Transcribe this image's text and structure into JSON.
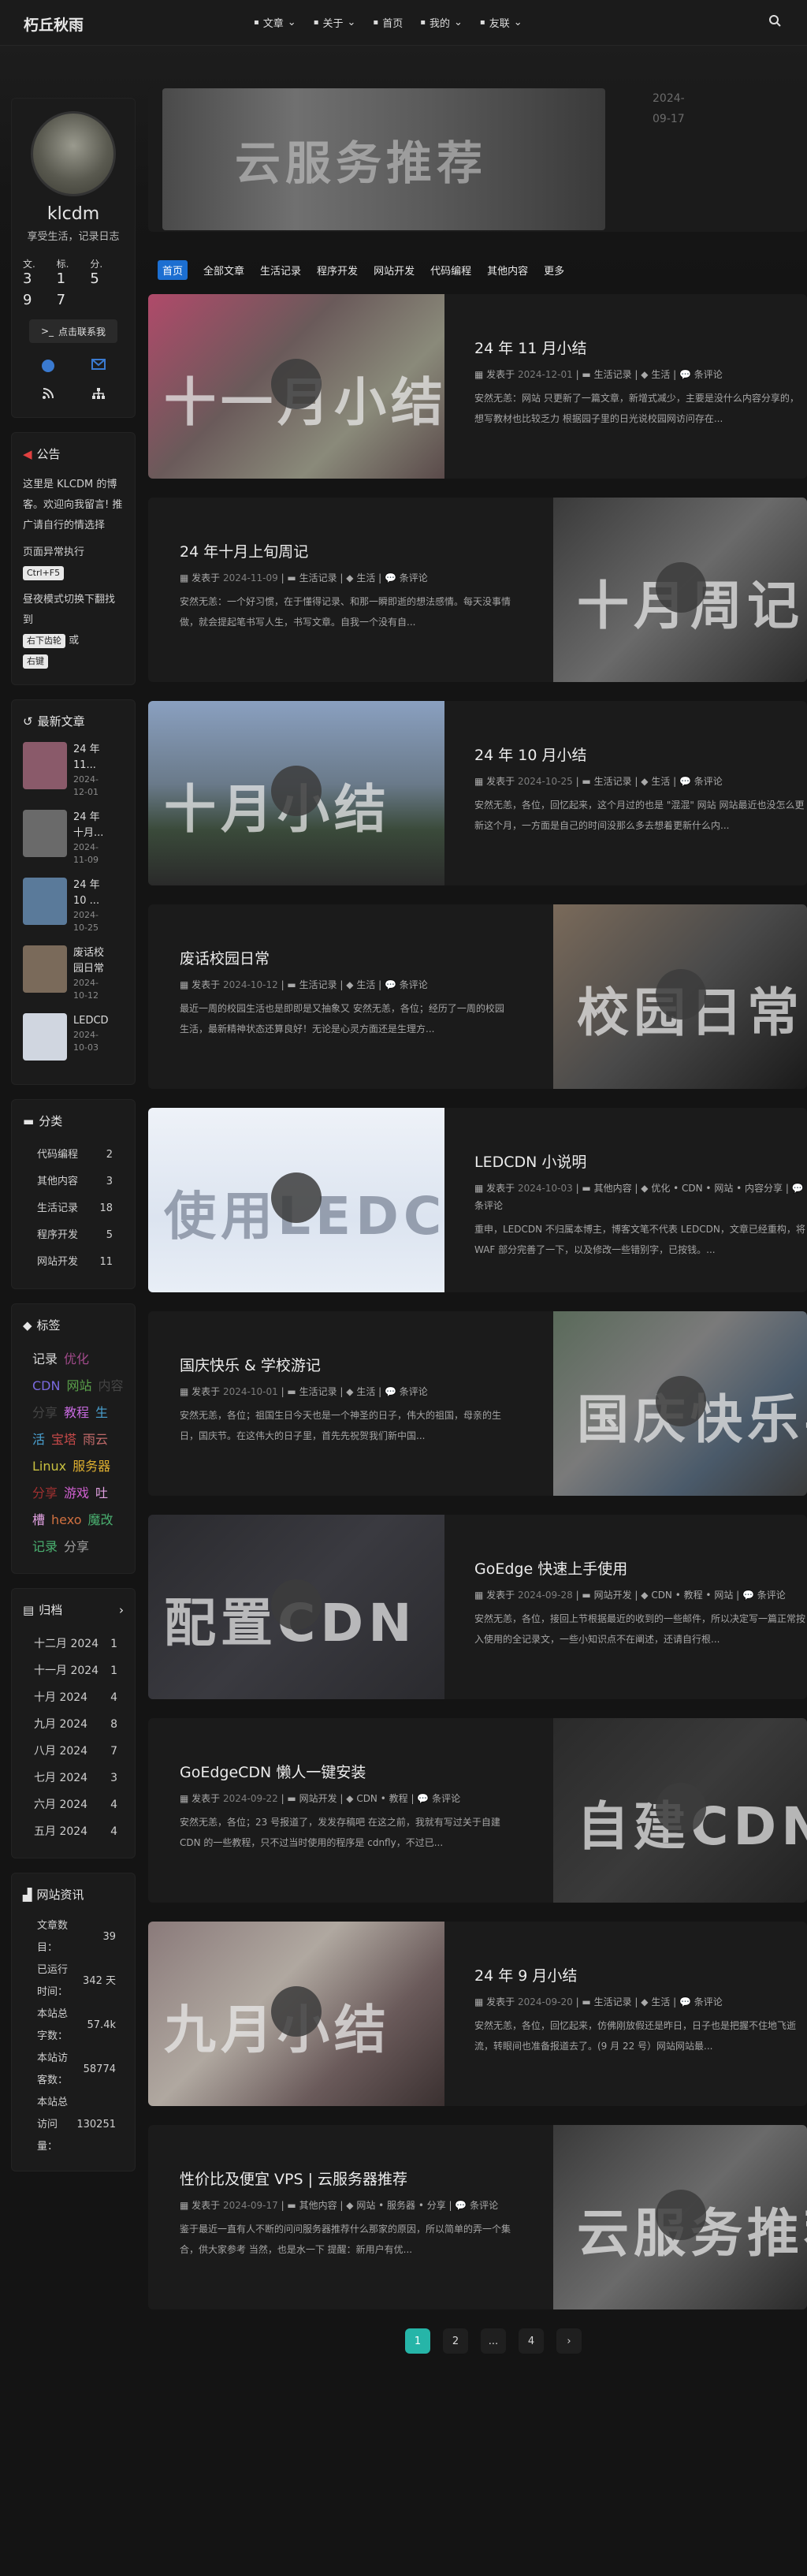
{
  "nav": {
    "brand": "朽丘秋雨",
    "menu": [
      {
        "label": "文章",
        "icon": "book-icon",
        "caret": true
      },
      {
        "label": "关于",
        "icon": "list-icon",
        "caret": true
      },
      {
        "label": "首页",
        "icon": "home-icon",
        "caret": false
      },
      {
        "label": "我的",
        "icon": "file-icon",
        "caret": true
      },
      {
        "label": "友联",
        "icon": "link-icon",
        "caret": true
      }
    ]
  },
  "profile": {
    "name": "klcdm",
    "desc": "享受生活，记录日志",
    "stats": [
      {
        "label": "文.",
        "value": "3"
      },
      {
        "label": "标.",
        "value": "1"
      },
      {
        "label": "分.",
        "value": "5"
      },
      {
        "label": "",
        "value": "9"
      },
      {
        "label": "",
        "value": "7"
      }
    ],
    "contact_button": "点击联系我",
    "socials": [
      "github-icon",
      "mail-icon",
      "rss-icon",
      "sitemap-icon"
    ]
  },
  "notice": {
    "title": "公告",
    "text1": "这里是 KLCDM 的博客。欢迎向我留言! 推广请自行的情选择",
    "text2": "页面异常执行",
    "key1": "Ctrl+F5",
    "text3": "昼夜模式切换下翻找到",
    "key2": "右下齿轮",
    "text4": "或",
    "key3": "右键"
  },
  "recent": {
    "title": "最新文章",
    "items": [
      {
        "title": "24 年 11...",
        "date": "2024-12-01",
        "color": "#8a5a6a"
      },
      {
        "title": "24 年十月...",
        "date": "2024-11-09",
        "color": "#6a6a6a"
      },
      {
        "title": "24 年 10 ...",
        "date": "2024-10-25",
        "color": "#5a7a9a"
      },
      {
        "title": "废话校园日常",
        "date": "2024-10-12",
        "color": "#7a6a5a"
      },
      {
        "title": "LEDCDN...",
        "date": "2024-10-03",
        "color": "#d0d6e0"
      }
    ]
  },
  "categories": {
    "title": "分类",
    "items": [
      {
        "name": "代码编程",
        "count": "2"
      },
      {
        "name": "其他内容",
        "count": "3"
      },
      {
        "name": "生活记录",
        "count": "18"
      },
      {
        "name": "程序开发",
        "count": "5"
      },
      {
        "name": "网站开发",
        "count": "11"
      }
    ]
  },
  "tags": {
    "title": "标签",
    "items": [
      {
        "t": "记录",
        "c": "#d8d8d8"
      },
      {
        "t": "优化",
        "c": "#a04a8a"
      },
      {
        "t": "CDN",
        "c": "#7a6adf"
      },
      {
        "t": "网站",
        "c": "#5aa04a"
      },
      {
        "t": "内容分享",
        "c": "#444"
      },
      {
        "t": "教程",
        "c": "#c86ae0"
      },
      {
        "t": "生活",
        "c": "#4aa0d0"
      },
      {
        "t": "宝塔",
        "c": "#c84a4a"
      },
      {
        "t": "雨云",
        "c": "#c06a6a"
      },
      {
        "t": "Linux",
        "c": "#c8c040"
      },
      {
        "t": "服务器",
        "c": "#e0b030"
      },
      {
        "t": "分享",
        "c": "#a03030"
      },
      {
        "t": "游戏",
        "c": "#d060d0"
      },
      {
        "t": "吐槽",
        "c": "#e0a0e0"
      },
      {
        "t": "hexo",
        "c": "#d07040"
      },
      {
        "t": "魔改记录",
        "c": "#4ab070"
      },
      {
        "t": "分享",
        "c": "#a0a0a0"
      }
    ]
  },
  "archive": {
    "title": "归档",
    "items": [
      {
        "m": "十二月 2024",
        "n": "1"
      },
      {
        "m": "十一月 2024",
        "n": "1"
      },
      {
        "m": "十月 2024",
        "n": "4"
      },
      {
        "m": "九月 2024",
        "n": "8"
      },
      {
        "m": "八月 2024",
        "n": "7"
      },
      {
        "m": "七月 2024",
        "n": "3"
      },
      {
        "m": "六月 2024",
        "n": "4"
      },
      {
        "m": "五月 2024",
        "n": "4"
      }
    ]
  },
  "siteinfo": {
    "title": "网站资讯",
    "items": [
      {
        "k": "文章数目：",
        "v": "39"
      },
      {
        "k": "已运行时间：",
        "v": "342 天"
      },
      {
        "k": "本站总字数：",
        "v": "57.4k"
      },
      {
        "k": "本站访客数：",
        "v": "58774"
      },
      {
        "k": "本站总访问量：",
        "v": "130251"
      }
    ]
  },
  "hero": {
    "word": "云服务推荐",
    "date": "2024-09-17"
  },
  "tabs": [
    "首页",
    "全部文章",
    "生活记录",
    "程序开发",
    "网站开发",
    "代码编程",
    "其他内容",
    "更多"
  ],
  "posts": [
    {
      "title": "24 年 11 月小结",
      "word": "十一月小结",
      "date": "2024-12-01",
      "cats": "生活记录",
      "tags": "生活",
      "comment": "条评论",
      "excerpt": "安然无恙：网站 只更新了一篇文章，新增式减少，主要是没什么内容分享的，想写教材也比较乏力 根据园子里的日光说校园网访问存在...",
      "side": "l",
      "bg": "linear-gradient(135deg,#b04a6a,#6a5a5a 40%,#8a8a7a 70%,#5a4a4a)"
    },
    {
      "title": "24 年十月上旬周记",
      "word": "十月周记",
      "date": "2024-11-09",
      "cats": "生活记录",
      "tags": "生活",
      "comment": "条评论",
      "excerpt": "安然无恙：一个好习惯，在于懂得记录、和那一瞬即逝的想法感情。每天没事情做，就会提起笔书写人生，书写文章。自我一个没有自...",
      "side": "r",
      "bg": "linear-gradient(135deg,#3a3a3a,#6a6a6a 50%,#2a2a2a)"
    },
    {
      "title": "24 年 10 月小结",
      "word": "十月小结",
      "date": "2024-10-25",
      "cats": "生活记录",
      "tags": "生活",
      "comment": "条评论",
      "excerpt": "安然无恙，各位，回忆起来，这个月过的也是 \"混混\" 网站 网站最近也没怎么更新这个月，一方面是自己的时间没那么多去想着更新什么内...",
      "side": "l",
      "bg": "linear-gradient(180deg,#8aa0c0,#6a7a8a 45%,#3a4a3a 70%,#2a2a2a)"
    },
    {
      "title": "废话校园日常",
      "word": "校园日常",
      "date": "2024-10-12",
      "cats": "生活记录",
      "tags": "生活",
      "comment": "条评论",
      "excerpt": "最近一周的校园生活也是即即是又抽象又 安然无恙，各位；经历了一周的校园生活，最新精神状态还算良好！无论是心灵方面还是生理方...",
      "side": "r",
      "bg": "linear-gradient(135deg,#7a6a5a,#4a4a4a 50%,#1a1a1a)"
    },
    {
      "title": "LEDCDN 小说明",
      "word": "使用LEDCDN",
      "date": "2024-10-03",
      "cats": "其他内容",
      "tags": "优化 • CDN • 网站 • 内容分享",
      "comment": "条评论",
      "excerpt": "重申，LEDCDN 不归属本博主，博客文笔不代表 LEDCDN，文章已经重构，将 WAF 部分完善了一下，以及修改一些错别字，已按钱。...",
      "side": "l",
      "bg": "linear-gradient(180deg,#eef2f8,#dce4f0 60%,#e8eef6)"
    },
    {
      "title": "国庆快乐 & 学校游记",
      "word": "国庆快乐学校",
      "date": "2024-10-01",
      "cats": "生活记录",
      "tags": "生活",
      "comment": "条评论",
      "excerpt": "安然无恙，各位；祖国生日今天也是一个神圣的日子，伟大的祖国，母亲的生日，国庆节。在这伟大的日子里，首先先祝贺我们新中国...",
      "side": "r",
      "bg": "linear-gradient(135deg,#5a6a5a,#7a7a7a 40%,#4a5a6a 70%,#3a3a3a)"
    },
    {
      "title": "GoEdge 快速上手使用",
      "word": "配置CDN",
      "date": "2024-09-28",
      "cats": "网站开发",
      "tags": "CDN • 教程 • 网站",
      "comment": "条评论",
      "excerpt": "安然无恙，各位，接回上节根据最近的收到的一些邮件，所以决定写一篇正常按入使用的全记录文，一些小知识点不在阐述，还请自行根...",
      "side": "l",
      "bg": "linear-gradient(135deg,#2a2a2e,#3a3a40 50%,#2a2a2e)"
    },
    {
      "title": "GoEdgeCDN 懒人一键安装",
      "word": "自建CDN",
      "date": "2024-09-22",
      "cats": "网站开发",
      "tags": "CDN • 教程",
      "comment": "条评论",
      "excerpt": "安然无恙，各位；23 号报道了，发发存稿吧 在这之前，我就有写过关于自建 CDN 的一些教程，只不过当时使用的程序是 cdnfly，不过已...",
      "side": "r",
      "bg": "linear-gradient(135deg,#2a2a2a,#3a3a3a 50%,#222)"
    },
    {
      "title": "24 年 9 月小结",
      "word": "九月小结",
      "date": "2024-09-20",
      "cats": "生活记录",
      "tags": "生活",
      "comment": "条评论",
      "excerpt": "安然无恙，各位，回忆起来，仿佛刚放假还是昨日，日子也是把握不住地飞逝流，转眼间也准备报道去了。(9 月 22 号）网站网站最...",
      "side": "l",
      "bg": "linear-gradient(135deg,#8a7a7a,#b0a8a0 40%,#6a5a5a 70%,#3a3030)"
    },
    {
      "title": "性价比及便宜 VPS | 云服务器推荐",
      "word": "云服务推荐",
      "date": "2024-09-17",
      "cats": "其他内容",
      "tags": "网站 • 服务器 • 分享",
      "comment": "条评论",
      "excerpt": "鉴于最近一直有人不断的问问服务器推荐什么那家的原因，所以简单的弄一个集合，供大家参考 当然，也是水一下 提醒：新用户有优...",
      "side": "r",
      "bg": "linear-gradient(135deg,#3a3a3a,#6a6a6a 50%,#2a2a2a)"
    }
  ],
  "meta_labels": {
    "posted": "发表于"
  },
  "pager": [
    "1",
    "2",
    "...",
    "4"
  ]
}
